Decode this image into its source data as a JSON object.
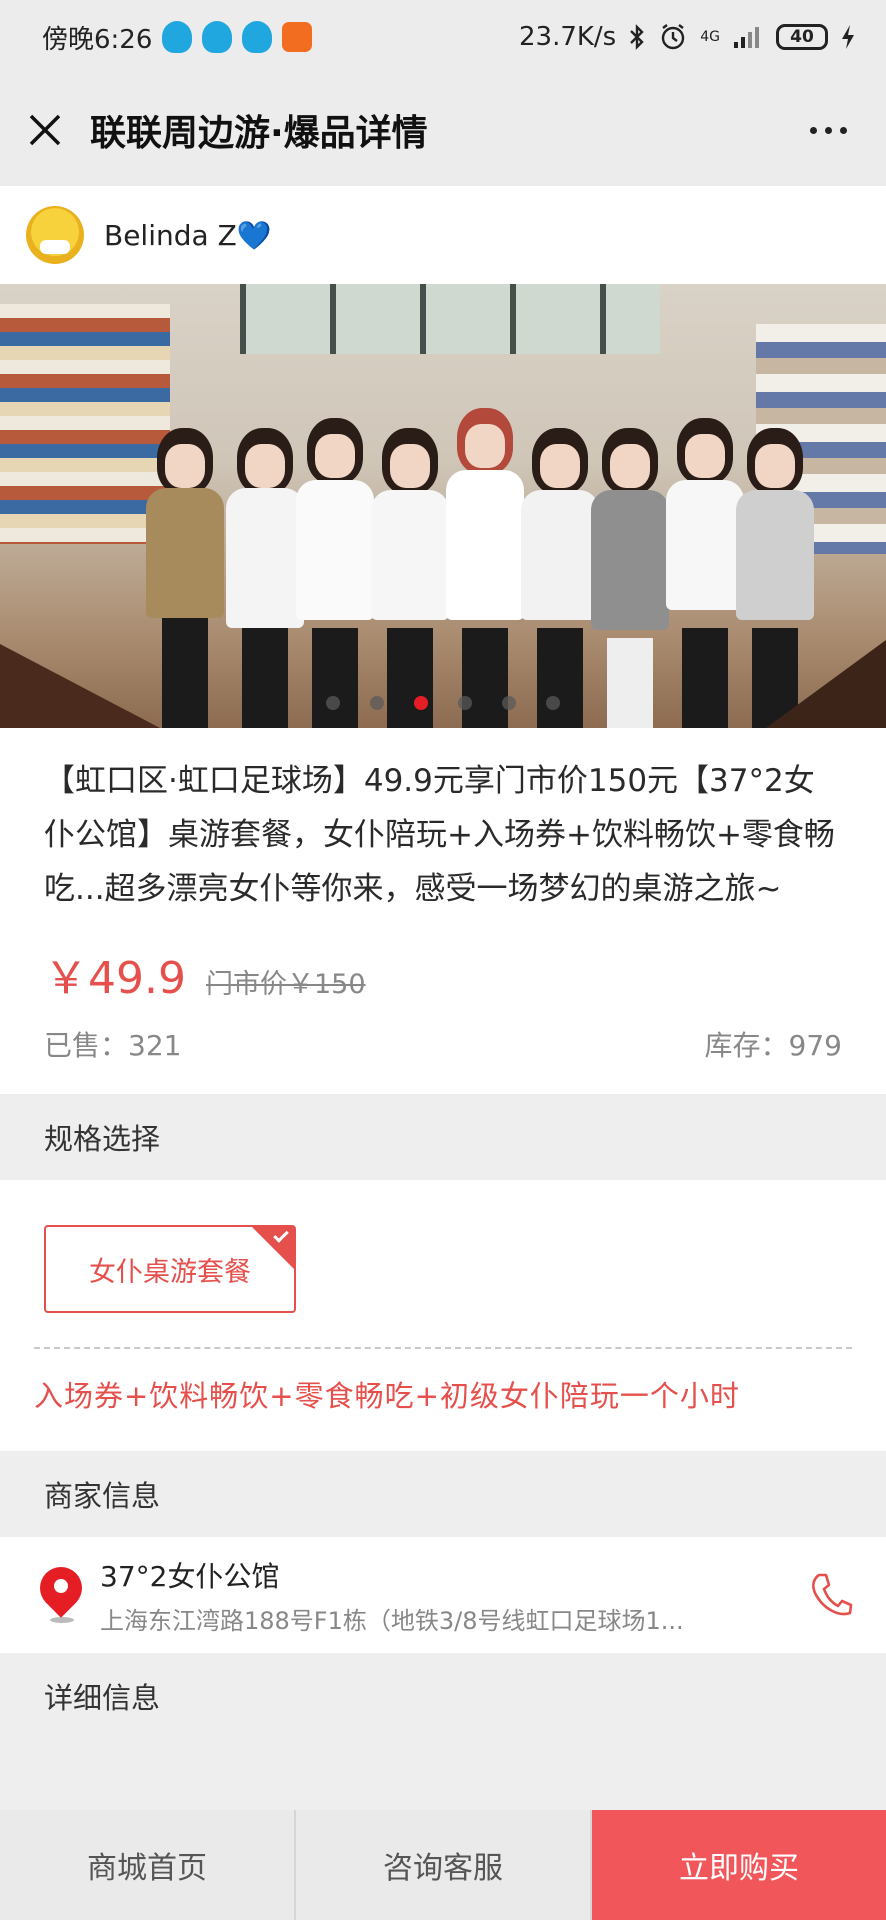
{
  "status_bar": {
    "time": "傍晚6:26",
    "network_speed": "23.7K/s",
    "network_type": "4G",
    "battery": "40",
    "icons": [
      "qq-icon",
      "qq-icon",
      "qq-icon",
      "app-icon",
      "bluetooth-icon",
      "alarm-icon",
      "signal-icon",
      "battery-icon",
      "charging-icon"
    ]
  },
  "titlebar": {
    "title": "联联周边游·爆品详情",
    "close_icon": "close-icon",
    "more_icon": "more-dots-icon"
  },
  "author": {
    "name": "Belinda Z💙"
  },
  "banner": {
    "slide_count": 6,
    "active_slide": 3
  },
  "product": {
    "title": "【虹口区·虹口足球场】49.9元享门市价150元【37°2女仆公馆】桌游套餐，女仆陪玩+入场券+饮料畅饮+零食畅吃...超多漂亮女仆等你来，感受一场梦幻的桌游之旅~",
    "price": "￥49.9",
    "market_price": "门市价￥150",
    "sold": "已售：321",
    "stock": "库存：979"
  },
  "sections": {
    "spec": "规格选择",
    "merchant": "商家信息",
    "details": "详细信息"
  },
  "spec": {
    "option_label": "女仆桌游套餐",
    "description": "入场券+饮料畅饮+零食畅吃+初级女仆陪玩一个小时"
  },
  "merchant": {
    "name": "37°2女仆公馆",
    "address": "上海东江湾路188号F1栋（地铁3/8号线虹口足球场1..."
  },
  "footer": {
    "home": "商城首页",
    "service": "咨询客服",
    "buy": "立即购买"
  },
  "colors": {
    "accent": "#e5504c",
    "buy_button": "#f0565a",
    "active_dot": "#e51e26"
  }
}
